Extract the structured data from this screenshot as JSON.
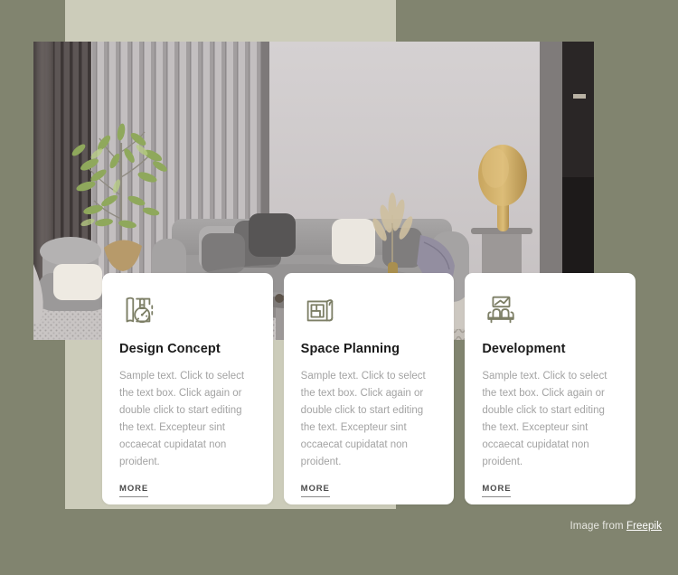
{
  "palette": {
    "outer_background": "#81846F",
    "panel_background": "#CCCCBA",
    "card_background": "#FFFFFF",
    "icon_color": "#7D7F66",
    "title_color": "#1B1B1B",
    "body_text_color": "#A3A3A3",
    "more_link_color": "#4A4A4A"
  },
  "hero": {
    "alt": "Modern living room interior with grey sectional sofa, slatted wall panelling, potted olive tree, gold table lamp and knitted pouf"
  },
  "cards": [
    {
      "icon": "design-concept-icon",
      "title": "Design Concept",
      "body": "Sample text. Click to select the text box. Click again or double click to start editing the text. Excepteur sint occaecat cupidatat non proident.",
      "link_label": "MORE"
    },
    {
      "icon": "floor-plan-icon",
      "title": "Space Planning",
      "body": "Sample text. Click to select the text box. Click again or double click to start editing the text. Excepteur sint occaecat cupidatat non proident.",
      "link_label": "MORE"
    },
    {
      "icon": "sofa-icon",
      "title": "Development",
      "body": "Sample text. Click to select the text box. Click again or double click to start editing the text. Excepteur sint occaecat cupidatat non proident.",
      "link_label": "MORE"
    }
  ],
  "attribution": {
    "prefix": "Image from ",
    "link_label": "Freepik"
  }
}
